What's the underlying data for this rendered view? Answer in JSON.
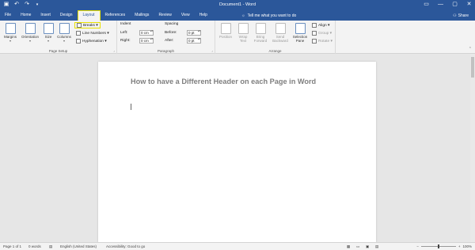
{
  "window": {
    "title": "Document1 - Word"
  },
  "qat": {
    "save_icon": "save-icon",
    "undo_icon": "undo-icon",
    "redo_icon": "redo-icon"
  },
  "tabs": [
    {
      "label": "File"
    },
    {
      "label": "Home"
    },
    {
      "label": "Insert"
    },
    {
      "label": "Design"
    },
    {
      "label": "Layout"
    },
    {
      "label": "References"
    },
    {
      "label": "Mailings"
    },
    {
      "label": "Review"
    },
    {
      "label": "View"
    },
    {
      "label": "Help"
    }
  ],
  "active_tab": "Layout",
  "tellme": {
    "text": "Tell me what you want to do"
  },
  "share": {
    "label": "Share"
  },
  "ribbon": {
    "page_setup": {
      "label": "Page Setup",
      "margins": "Margins",
      "orientation": "Orientation",
      "size": "Size",
      "columns": "Columns",
      "breaks": "Breaks ▾",
      "line_numbers": "Line Numbers ▾",
      "hyphenation": "Hyphenation ▾"
    },
    "paragraph": {
      "label": "Paragraph",
      "indent_heading": "Indent",
      "spacing_heading": "Spacing",
      "left_label": "Left:",
      "right_label": "Right:",
      "before_label": "Before:",
      "after_label": "After:",
      "left_value": "0 cm",
      "right_value": "0 cm",
      "before_value": "0 pt",
      "after_value": "0 pt"
    },
    "arrange": {
      "label": "Arrange",
      "position": "Position",
      "wrap_text": "Wrap Text",
      "bring_forward": "Bring Forward",
      "send_backward": "Send Backward",
      "selection_pane": "Selection Pane",
      "align": "Align ▾",
      "group": "Group ▾",
      "rotate": "Rotate ▾"
    }
  },
  "document": {
    "heading": "How to have a Different Header on each Page in Word"
  },
  "statusbar": {
    "page": "Page 1 of 1",
    "words": "0 words",
    "language": "English (United States)",
    "accessibility": "Accessibility: Good to go",
    "zoom": "100%"
  },
  "colors": {
    "brand": "#2b579a",
    "highlight": "#e8e000"
  }
}
